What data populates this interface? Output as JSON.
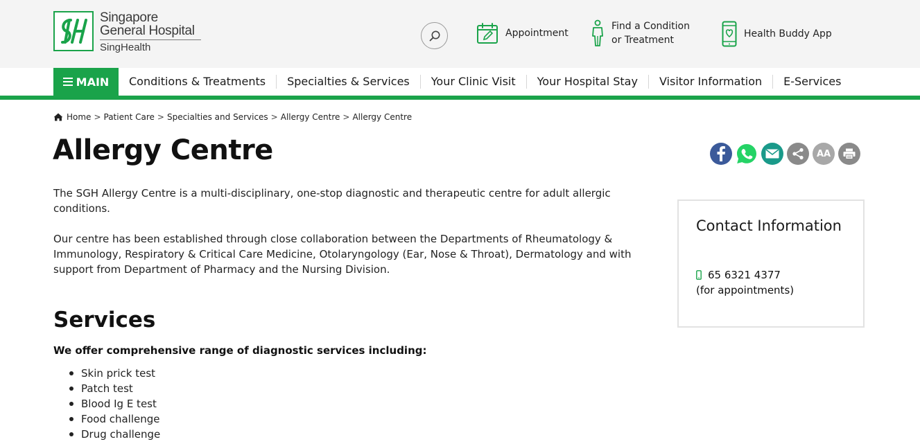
{
  "header": {
    "logo": {
      "line1": "Singapore",
      "line2": "General Hospital",
      "line3": "SingHealth"
    },
    "quick_links": [
      {
        "label": "Appointment",
        "icon": "calendar-edit-icon"
      },
      {
        "label": "Find a Condition or Treatment",
        "line1": "Find a Condition",
        "line2": "or Treatment",
        "icon": "person-icon"
      },
      {
        "label": "Health Buddy App",
        "icon": "phone-heart-icon"
      }
    ]
  },
  "nav": {
    "main_label": "MAIN",
    "items": [
      "Conditions & Treatments",
      "Specialties & Services",
      "Your Clinic Visit",
      "Your Hospital Stay",
      "Visitor Information",
      "E-Services"
    ]
  },
  "breadcrumb": [
    "Home",
    "Patient Care",
    "Specialties and Services",
    "Allergy Centre",
    "Allergy Centre"
  ],
  "page": {
    "title": "Allergy Centre",
    "paragraphs": [
      "The SGH Allergy Centre is a multi-disciplinary, one-stop diagnostic and therapeutic centre for adult allergic conditions.",
      "Our centre has been established through close collaboration between the Departments of Rheumatology & Immunology, Respiratory & Critical Care Medicine, Otolaryngology (Ear, Nose & Throat), Dermatology and with support from Department of Pharmacy and the Nursing Division."
    ],
    "services_heading": "Services",
    "services_intro": "We offer comprehensive range of diagnostic services including:",
    "services": [
      "Skin prick test",
      "Patch test",
      "Blood Ig E test",
      "Food challenge",
      "Drug challenge"
    ]
  },
  "share": {
    "buttons": [
      "facebook-icon",
      "whatsapp-icon",
      "email-icon",
      "share-icon",
      "font-size-icon",
      "print-icon"
    ],
    "font_label": "AA"
  },
  "contact": {
    "title": "Contact Information",
    "phone": "65 6321 4377",
    "note": "(for appointments)"
  },
  "colors": {
    "brand_green": "#1aa34a",
    "facebook": "#3b5a9a",
    "whatsapp": "#25d366",
    "email": "#1a9a8a",
    "grey_icon": "#8a8a8a"
  }
}
